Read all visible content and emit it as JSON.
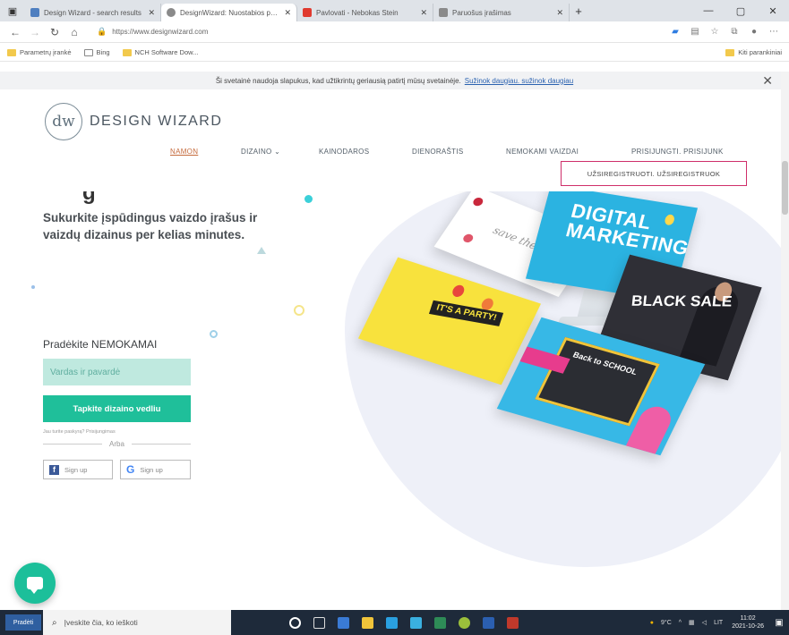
{
  "browser": {
    "tabs": [
      {
        "label": "Design Wizard - search results",
        "favicon_color": "#4f7fc0",
        "active": false
      },
      {
        "label": "DesignWizard: Nuostabios papr.",
        "favicon_color": "#8a8a8a",
        "active": true
      },
      {
        "label": "Pavlovati - Nebokas Stein",
        "favicon_color": "#e03a2f",
        "active": false
      },
      {
        "label": "Paruošus įrašimas",
        "favicon_color": "#8a8a8a",
        "active": false
      }
    ],
    "url": "https://www.designwizard.com",
    "bookmarks": [
      {
        "label": "Parametrų įrankė"
      },
      {
        "label": "Bing"
      },
      {
        "label": "NCH Software Dow..."
      }
    ],
    "bookmarks_right": "Kiti parankiniai"
  },
  "cookie_banner": {
    "text": "Ši svetainė naudoja slapukus, kad užtikrintų geriausią patirtį mūsų svetainėje.",
    "link": "Sužinok daugiau. sužinok daugiau"
  },
  "site": {
    "logo_mark": "dw",
    "logo_text": "DESIGN WIZARD",
    "menu": [
      {
        "label": "NAMON",
        "active": true
      },
      {
        "label": "DIZAINO ⌄",
        "active": false
      },
      {
        "label": "KAINODAROS",
        "active": false
      },
      {
        "label": "DIENORAŠTIS",
        "active": false
      },
      {
        "label": "NEMOKAMI VAIZDAI",
        "active": false
      },
      {
        "label": "PRISIJUNGTI. PRISIJUNK",
        "active": false
      }
    ],
    "submenu_item": "UŽSIREGISTRUOTI. UŽSIREGISTRUOK"
  },
  "hero": {
    "headline_fragment": "g",
    "tagline": "Sukurkite įspūdingus vaizdo įrašus ir vaizdų dizainus per kelias minutes.",
    "form_title": "Pradėkite NEMOKAMAI",
    "name_placeholder": "Vardas ir pavardė",
    "cta_label": "Tapkite dizaino vedliu",
    "login_hint": "Jau turite paskyrą? Prisijungimas",
    "or_label": "Arba",
    "facebook_signup": "Sign up",
    "google_signup": "Sign up"
  },
  "collage": {
    "monitor_text": "DIGITAL MARKETING",
    "party_text": "IT'S A PARTY!",
    "black_text": "BLACK SALE",
    "school_text": "Back to SCHOOL"
  },
  "taskbar": {
    "start_label": "Pradėti",
    "search_placeholder": "Įveskite čia, ko ieškoti",
    "tray_temp": "9°C",
    "tray_lang": "LIT",
    "clock_time": "11:02",
    "clock_date": "2021-10-26",
    "app_icon_colors": [
      "#ffffff",
      "#3a7bd5",
      "#f0c43a",
      "#2aa0e0",
      "#3ab0e0",
      "#2e8b57",
      "#9bbf3b",
      "#2b5fb0",
      "#c0392b"
    ]
  },
  "colors": {
    "accent_teal": "#1fbf9a",
    "input_mint": "#bfe9df",
    "nav_active": "#c56a3c",
    "submenu_border": "#cf2f6a"
  }
}
